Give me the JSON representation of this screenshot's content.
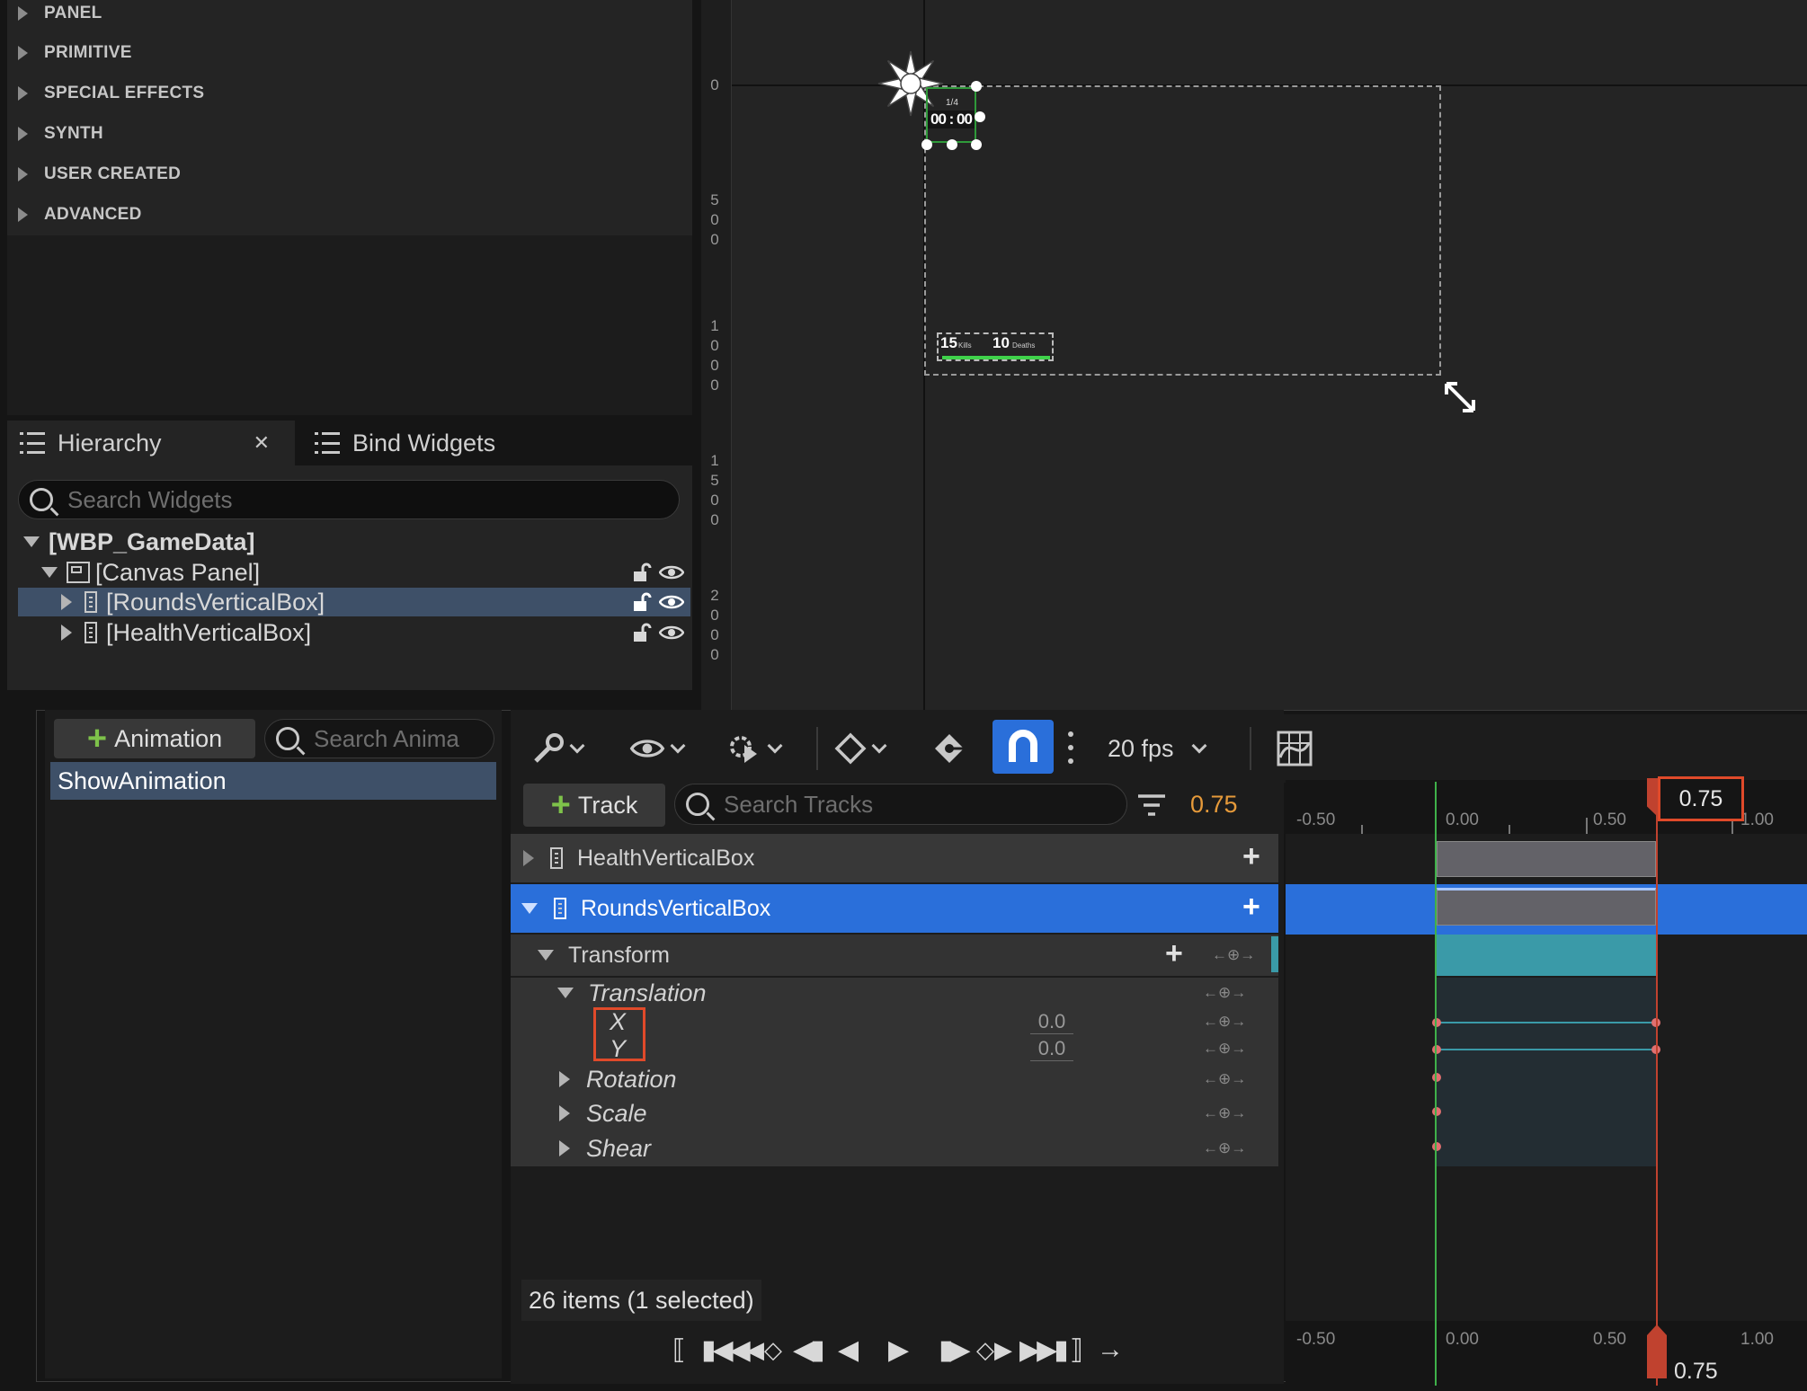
{
  "palette": {
    "categories": [
      "PANEL",
      "PRIMITIVE",
      "SPECIAL EFFECTS",
      "SYNTH",
      "USER CREATED",
      "ADVANCED"
    ]
  },
  "hierarchy": {
    "tab_label": "Hierarchy",
    "bind_tab_label": "Bind Widgets",
    "close_glyph": "✕",
    "search_placeholder": "Search Widgets",
    "root": "[WBP_GameData]",
    "canvas": "[Canvas Panel]",
    "children": [
      "[RoundsVerticalBox]",
      "[HealthVerticalBox]"
    ]
  },
  "designer": {
    "ruler_labels": [
      "0",
      "5\n0\n0",
      "1\n0\n0\n0",
      "1\n5\n0\n0",
      "2\n0\n0\n0"
    ],
    "hud_timer": "00 : 00",
    "hud_round": "1/4",
    "hud_kills_value": "15",
    "hud_kills_label": "Kills",
    "hud_deaths_value": "10",
    "hud_deaths_label": "Deaths"
  },
  "animations": {
    "add_label": "Animation",
    "search_placeholder": "Search Anima",
    "items": [
      "ShowAnimation"
    ]
  },
  "sequencer": {
    "fps_label": "20 fps",
    "add_track_label": "Track",
    "search_tracks_placeholder": "Search Tracks",
    "current_time": "0.75",
    "status": "26 items (1 selected)",
    "tracks": {
      "health": "HealthVerticalBox",
      "rounds": "RoundsVerticalBox",
      "transform": "Transform",
      "translation": "Translation",
      "x_label": "X",
      "y_label": "Y",
      "x_value": "0.0",
      "y_value": "0.0",
      "rotation": "Rotation",
      "scale": "Scale",
      "shear": "Shear"
    },
    "timeline_ticks": [
      "-0.50",
      "0.00",
      "0.50",
      "1.00"
    ],
    "playhead_label": "0.75",
    "colors": {
      "accent_blue": "#2a6fda",
      "playhead": "#c0422f",
      "teal": "#3a9aa8",
      "range_green": "#3fb04a"
    }
  }
}
